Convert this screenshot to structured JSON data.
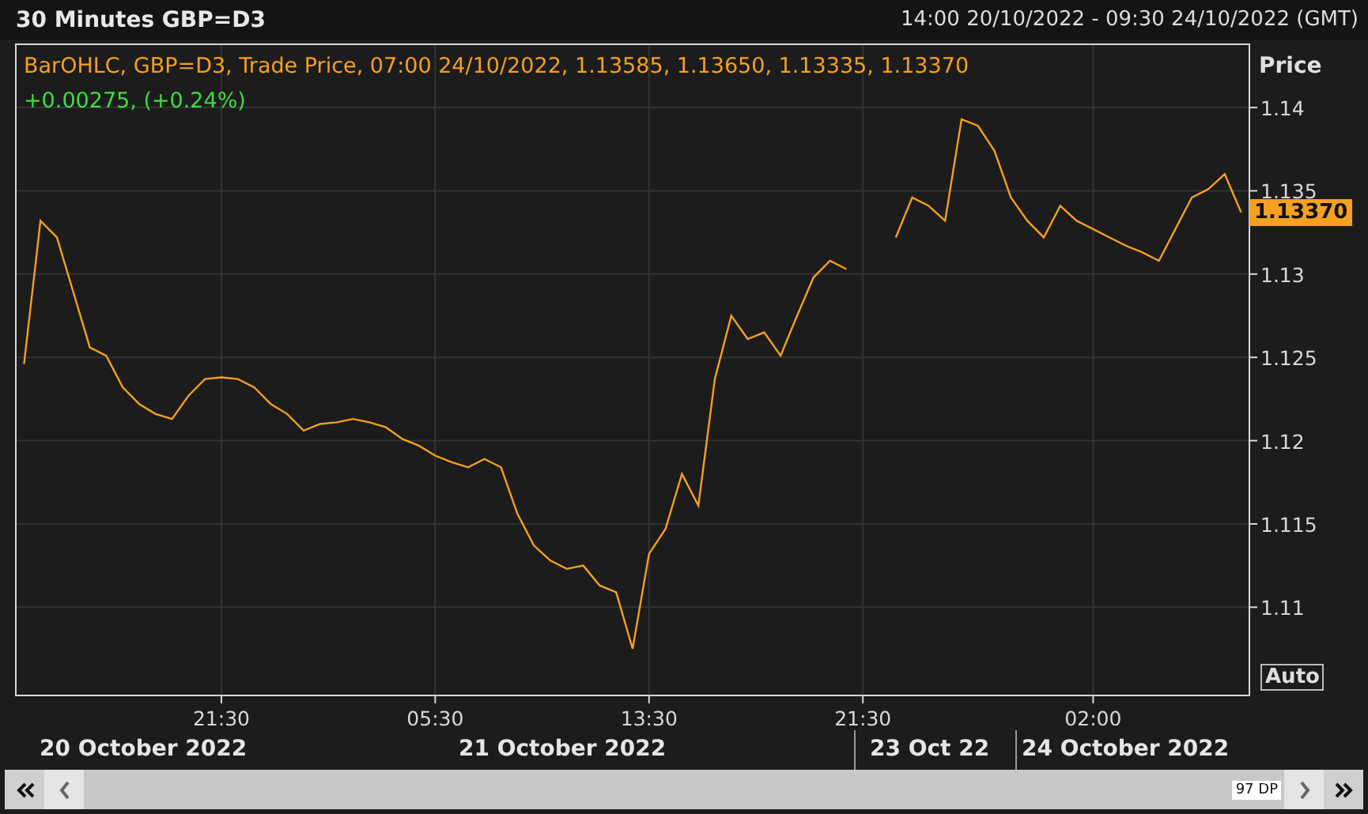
{
  "header": {
    "title": "30 Minutes GBP=D3",
    "range": "14:00 20/10/2022 - 09:30 24/10/2022 (GMT)"
  },
  "legend": {
    "series_info": "BarOHLC, GBP=D3, Trade Price, 07:00 24/10/2022, 1.13585, 1.13650, 1.13335, 1.13370",
    "change": "+0.00275, (+0.24%)"
  },
  "chart": {
    "last_price": "1.13370",
    "auto_button": "Auto",
    "chart_data": {
      "type": "line",
      "ylabel": "Price",
      "grid": true,
      "ylim": [
        1.1047,
        1.1438
      ],
      "yticks": [
        1.11,
        1.115,
        1.12,
        1.125,
        1.13,
        1.135,
        1.14
      ],
      "categories": [
        null,
        null,
        null,
        null,
        null,
        null,
        null,
        null,
        null,
        null,
        null,
        null,
        "21:30",
        null,
        null,
        null,
        null,
        null,
        null,
        null,
        null,
        null,
        null,
        null,
        null,
        "05:30",
        null,
        null,
        null,
        null,
        null,
        null,
        null,
        null,
        null,
        null,
        null,
        null,
        "13:30",
        null,
        null,
        null,
        null,
        null,
        null,
        null,
        null,
        null,
        null,
        null,
        null,
        "21:30",
        null,
        null,
        null,
        null,
        null,
        null,
        null,
        null,
        null,
        null,
        null,
        null,
        null,
        "02:00",
        null,
        null,
        null,
        null,
        null,
        null,
        null,
        null,
        null
      ],
      "series": [
        {
          "color": "#f5a01e",
          "values": [
            1.1246,
            1.1332,
            1.1322,
            1.1289,
            1.1256,
            1.1251,
            1.1232,
            1.1222,
            1.1216,
            1.1213,
            1.1227,
            1.1237,
            1.1238,
            1.1237,
            1.1232,
            1.1222,
            1.1216,
            1.1206,
            1.121,
            1.1211,
            1.1213,
            1.1211,
            1.1208,
            1.1201,
            1.1197,
            1.1191,
            1.1187,
            1.1184,
            1.1189,
            1.1184,
            1.1156,
            1.1137,
            1.1128,
            1.1123,
            1.1125,
            1.1113,
            1.1109,
            1.1075,
            1.1132,
            1.1147,
            1.118,
            1.1161,
            1.1237,
            1.1275,
            1.1261,
            1.1265,
            1.1251,
            1.1275,
            1.1298,
            1.1308,
            1.1303,
            null,
            null,
            1.1322,
            1.1346,
            1.1341,
            1.1332,
            1.1393,
            1.1389,
            1.1374,
            1.1346,
            1.1332,
            1.1322,
            1.1341,
            1.1332,
            1.1327,
            1.1322,
            1.1317,
            1.1313,
            1.1308,
            1.1327,
            1.1346,
            1.1351,
            1.136,
            1.1337
          ]
        }
      ]
    }
  },
  "dates": [
    {
      "label": "20 October 2022"
    },
    {
      "label": "21 October 2022"
    },
    {
      "label": "23 Oct 22"
    },
    {
      "label": "24 October 2022"
    }
  ],
  "scrollbar": {
    "count": "97 DP"
  }
}
